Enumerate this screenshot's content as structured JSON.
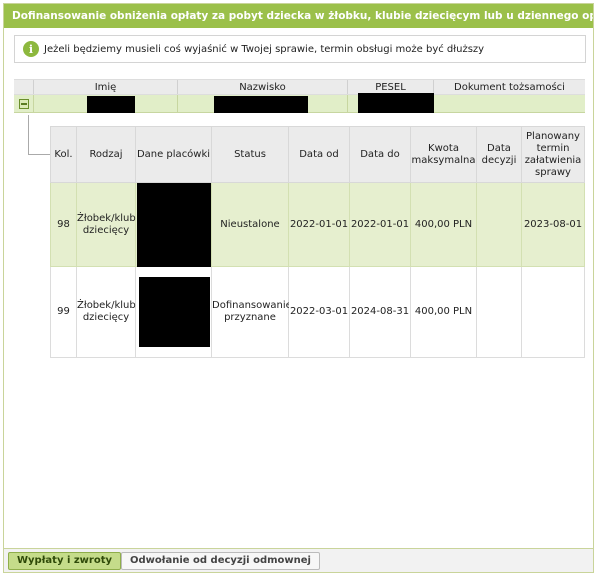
{
  "panel": {
    "title": "Dofinansowanie obniżenia opłaty za pobyt dziecka w żłobku, klubie dziecięcym lub u dziennego opiekuna"
  },
  "info": {
    "icon": "info-icon",
    "text": "Jeżeli będziemy musieli coś wyjaśnić w Twojej sprawie, termin obsługi może być dłuższy"
  },
  "person_table": {
    "headers": [
      "Imię",
      "Nazwisko",
      "PESEL",
      "Dokument tożsamości"
    ]
  },
  "sub_table": {
    "headers": [
      "Kol.",
      "Rodzaj",
      "Dane placówki",
      "Status",
      "Data od",
      "Data do",
      "Kwota maksymalna",
      "Data decyzji",
      "Planowany termin załatwienia sprawy"
    ],
    "rows": [
      {
        "kol": "98",
        "rodzaj": "Żłobek/klub dziecięcy",
        "status": "Nieustalone",
        "data_od": "2022-01-01",
        "data_do": "2022-01-01",
        "kwota": "400,00 PLN",
        "data_decyzji": "",
        "termin": "2023-08-01"
      },
      {
        "kol": "99",
        "rodzaj": "Żłobek/klub dziecięcy",
        "status": "Dofinansowanie przyznane",
        "data_od": "2022-03-01",
        "data_do": "2024-08-31",
        "kwota": "400,00 PLN",
        "data_decyzji": "",
        "termin": ""
      }
    ]
  },
  "footer": {
    "btn_payments": "Wypłaty i zwroty",
    "btn_appeal": "Odwołanie od decyzji odmownej"
  }
}
